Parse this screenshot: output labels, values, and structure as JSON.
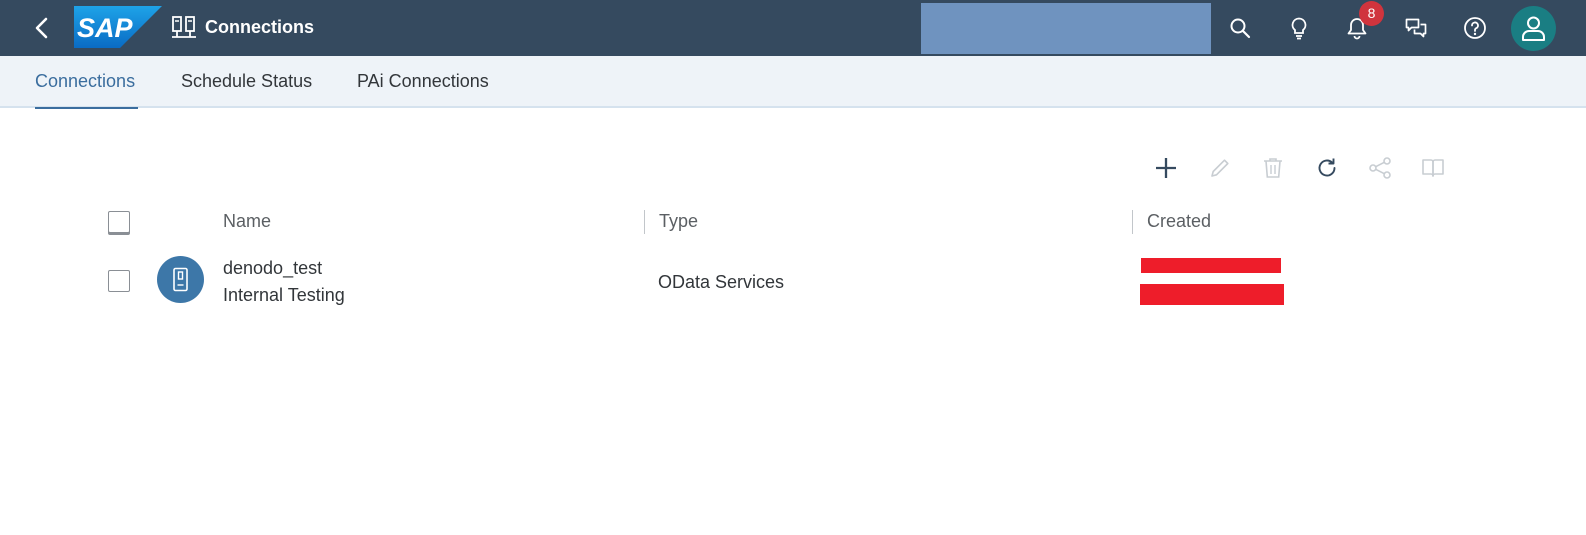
{
  "shell": {
    "title": "Connections",
    "notification_count": "8",
    "icons": {
      "back": "chevron-left-icon",
      "app": "connection-icon",
      "search": "search-icon",
      "whats_new": "lightbulb-icon",
      "notifications": "bell-icon",
      "feedback": "chat-icon",
      "help": "help-icon",
      "user": "user-icon"
    },
    "colors": {
      "bar": "#354a5f",
      "search_box": "#6f93bf",
      "badge": "#d0343d",
      "avatar": "#1a7e83"
    }
  },
  "tabs": [
    {
      "label": "Connections",
      "selected": true
    },
    {
      "label": "Schedule Status",
      "selected": false
    },
    {
      "label": "PAi Connections",
      "selected": false
    }
  ],
  "toolbar": {
    "icons": [
      "add-icon",
      "edit-icon",
      "delete-icon",
      "refresh-icon",
      "share-icon",
      "book-icon"
    ]
  },
  "table": {
    "columns": [
      "Name",
      "Type",
      "Created"
    ],
    "rows": [
      {
        "name": "denodo_test",
        "description": "Internal Testing",
        "type": "OData Services",
        "icon": "connection-device-icon"
      }
    ]
  }
}
